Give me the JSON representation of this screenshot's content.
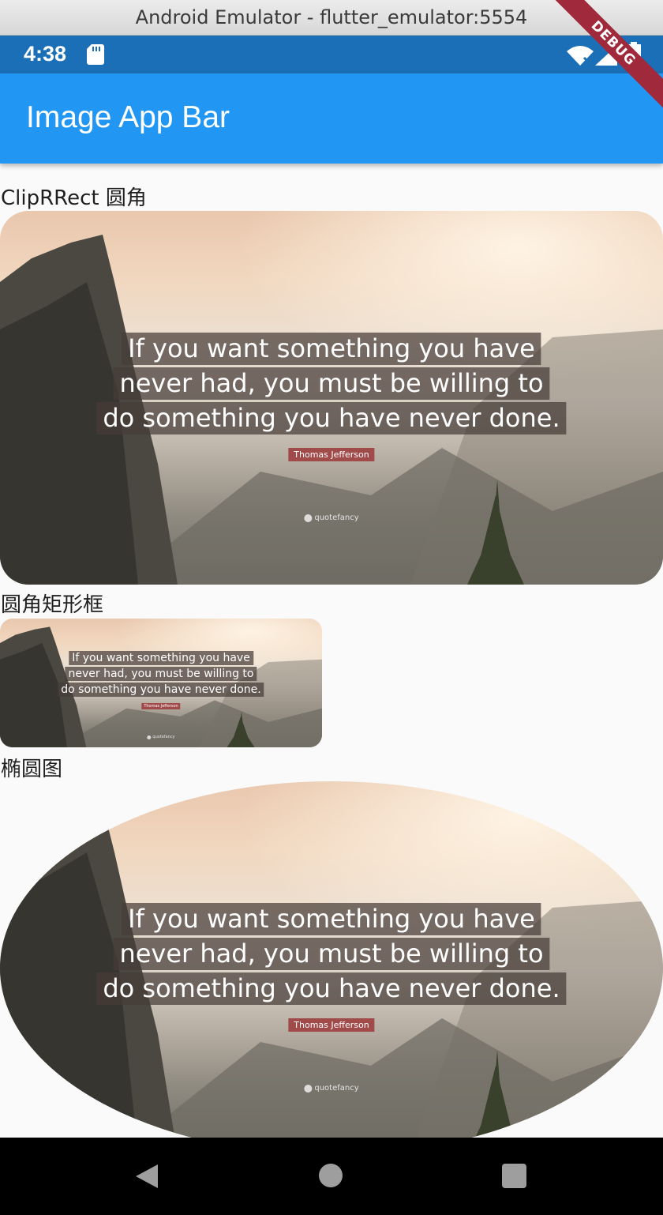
{
  "window": {
    "title": "Android Emulator - flutter_emulator:5554"
  },
  "status_bar": {
    "time": "4:38",
    "icons": [
      "sd-card-icon",
      "wifi-icon",
      "signal-icon",
      "battery-icon"
    ],
    "color": "#1b6fb7"
  },
  "app_bar": {
    "title": "Image App Bar",
    "color": "#2196f3"
  },
  "debug_banner": {
    "label": "DEBUG",
    "color": "#a0293b"
  },
  "sections": [
    {
      "label": "ClipRRect 圆角"
    },
    {
      "label": "圆角矩形框"
    },
    {
      "label": "椭圆图"
    }
  ],
  "image": {
    "quote_lines": [
      "If you want something you have",
      "never had, you must be willing to",
      "do something you have never done."
    ],
    "author": "Thomas Jefferson",
    "brand": "quotefancy"
  },
  "nav_bar": {
    "icons": [
      "back-icon",
      "home-icon",
      "recent-apps-icon"
    ]
  }
}
